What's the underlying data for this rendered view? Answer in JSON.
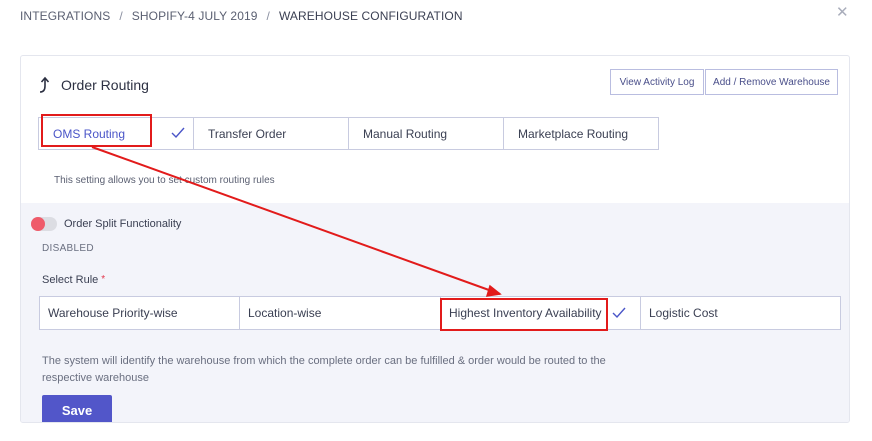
{
  "breadcrumb": {
    "items": [
      "INTEGRATIONS",
      "SHOPIFY-4 JULY 2019",
      "WAREHOUSE CONFIGURATION"
    ],
    "separator": "/"
  },
  "close": {
    "glyph": "✕",
    "icon": "close-icon"
  },
  "card": {
    "title": "Order Routing",
    "title_icon": "routing-arrow-icon",
    "view_log_label": "View Activity Log",
    "add_remove_label": "Add / Remove Warehouse"
  },
  "routing_tabs": [
    {
      "label": "OMS Routing",
      "selected": true
    },
    {
      "label": "Transfer Order",
      "selected": false
    },
    {
      "label": "Manual Routing",
      "selected": false
    },
    {
      "label": "Marketplace Routing",
      "selected": false
    }
  ],
  "routing_help": "This setting allows you to set custom routing rules",
  "split": {
    "label": "Order Split Functionality",
    "status": "DISABLED",
    "enabled": false
  },
  "rule": {
    "label": "Select Rule",
    "required_mark": "*",
    "options": [
      {
        "label": "Warehouse Priority-wise",
        "selected": false
      },
      {
        "label": "Location-wise",
        "selected": false
      },
      {
        "label": "Highest Inventory Availability",
        "selected": true
      },
      {
        "label": "Logistic Cost",
        "selected": false
      }
    ],
    "description": "The system will identify the warehouse from which the complete order can be fulfilled & order would be routed to the respective warehouse"
  },
  "save_label": "Save",
  "colors": {
    "accent": "#5256c9",
    "toggle_off": "#ef5b6a",
    "annotation": "#e21b1b",
    "panel_bg": "#f3f4fa"
  }
}
